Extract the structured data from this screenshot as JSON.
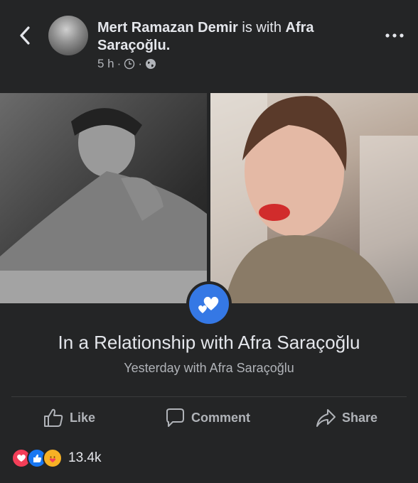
{
  "header": {
    "author": "Mert Ramazan Demir",
    "with_text": "is with",
    "tagged": "Afra Saraçoğlu.",
    "time": "5 h",
    "dot": "·"
  },
  "post": {
    "relationship_title": "In a Relationship with Afra Saraçoğlu",
    "relationship_sub": "Yesterday with Afra Saraçoğlu"
  },
  "actions": {
    "like": "Like",
    "comment": "Comment",
    "share": "Share"
  },
  "reactions": {
    "count": "13.4k",
    "types": [
      "love",
      "like",
      "care"
    ]
  },
  "colors": {
    "background": "#242526",
    "accent": "#3578e5",
    "text": "#e4e6eb",
    "secondary_text": "#b0b3b8"
  }
}
